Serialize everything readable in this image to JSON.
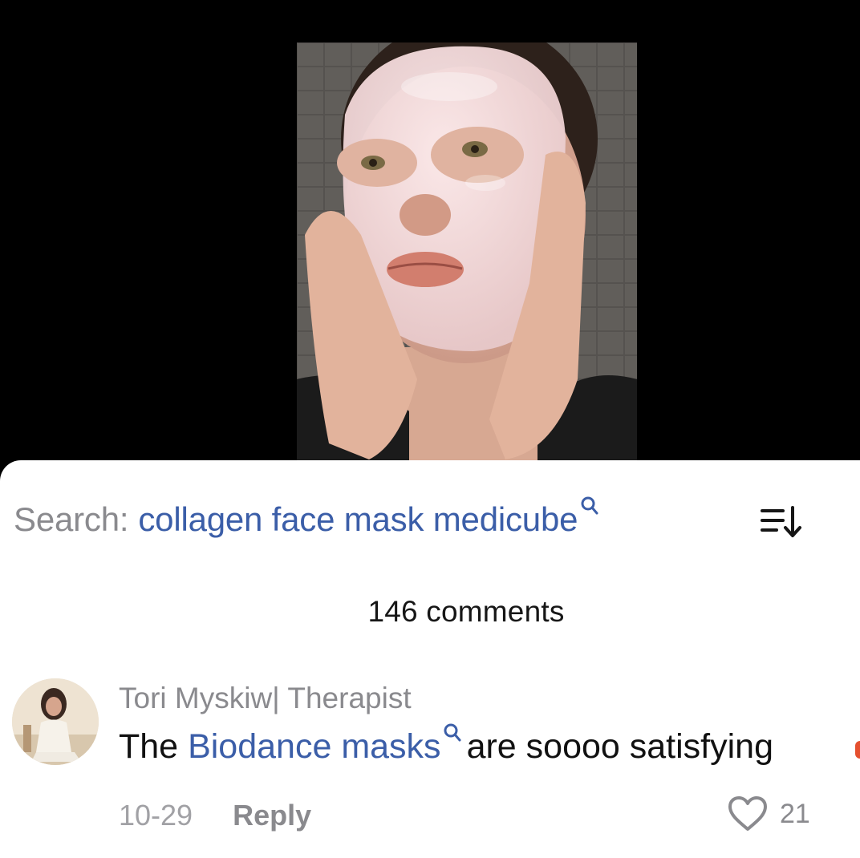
{
  "search": {
    "prefix": "Search:",
    "query": "collagen face mask medicube"
  },
  "comments_header": {
    "count_label": "146 comments"
  },
  "comment": {
    "username": "Tori Myskiw| Therapist",
    "text_before": "The",
    "mention": "Biodance masks",
    "text_after": "are soooo satisfying",
    "date": "10-29",
    "reply_label": "Reply",
    "like_count": "21"
  },
  "colors": {
    "link_blue": "#3b5ea8",
    "muted_gray": "#8a8a8e",
    "background_top": "#000000",
    "sheet_background": "#ffffff"
  },
  "icons": {
    "search_inline": "search-icon",
    "sort": "sort-icon",
    "like": "heart-outline-icon"
  }
}
